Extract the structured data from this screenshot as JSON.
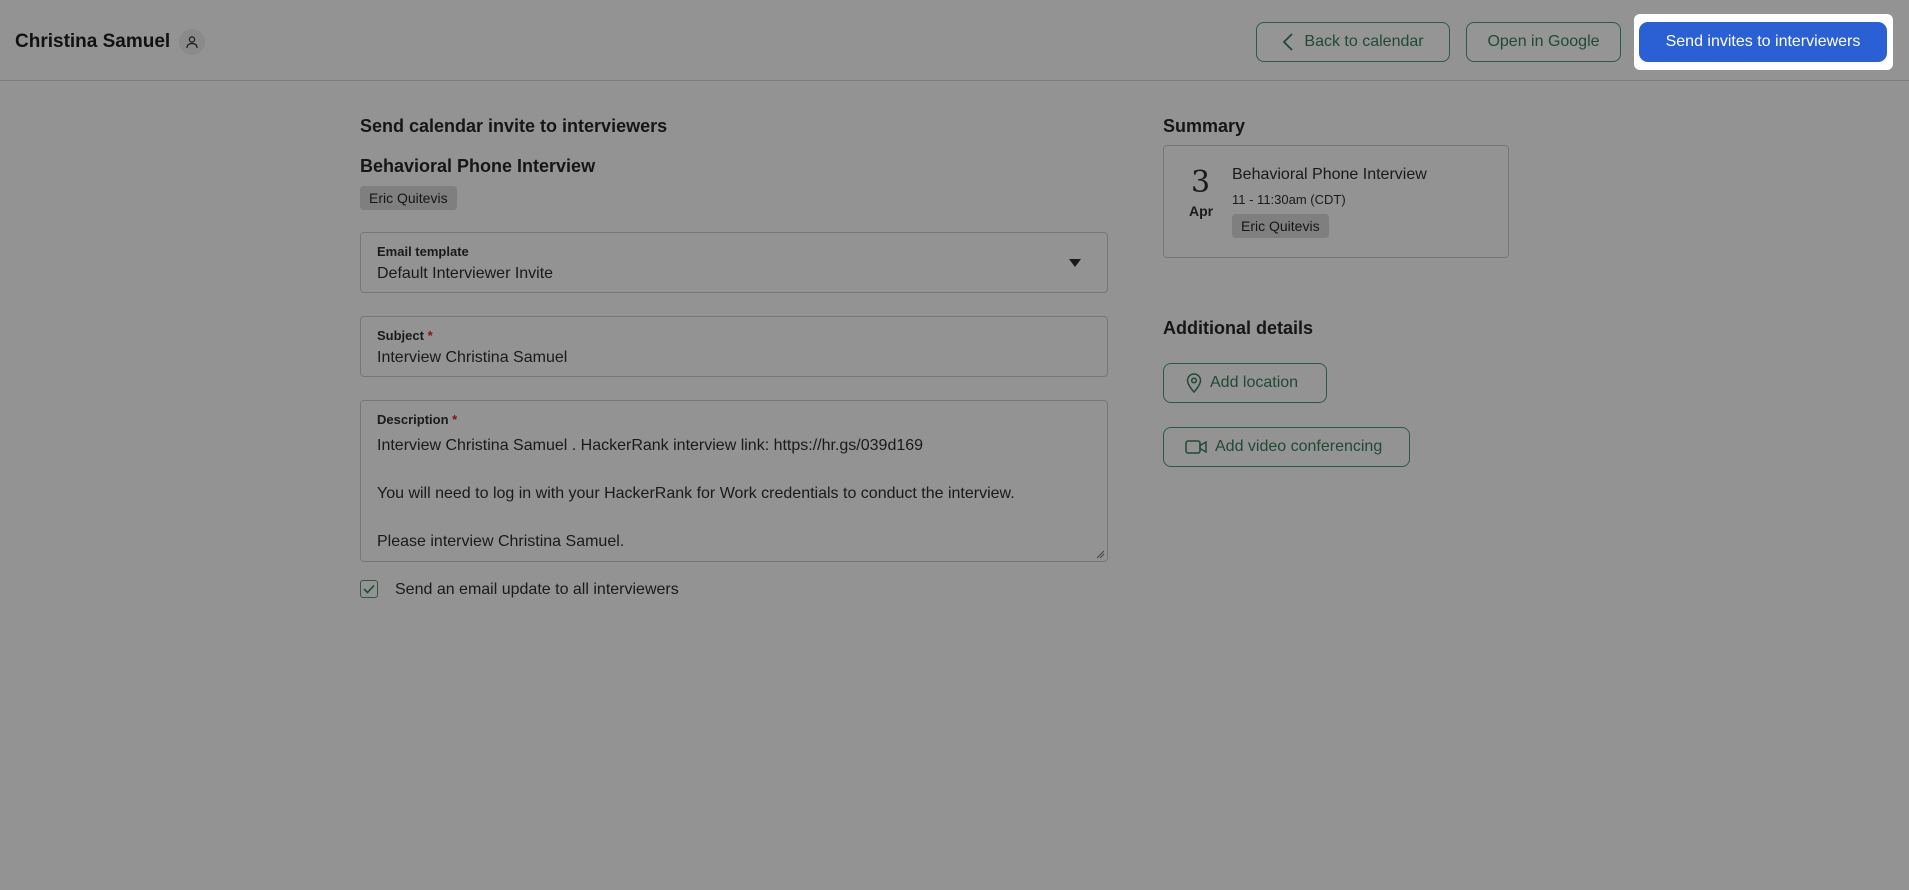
{
  "header": {
    "candidate_name": "Christina Samuel",
    "back_label": "Back to calendar",
    "google_label": "Open in Google",
    "send_label": "Send invites to interviewers"
  },
  "form": {
    "title": "Send calendar invite to interviewers",
    "interview_name": "Behavioral Phone Interview",
    "interviewer_chip": "Eric Quitevis",
    "email_template": {
      "label": "Email template",
      "value": "Default Interviewer Invite"
    },
    "subject": {
      "label": "Subject",
      "required_mark": "*",
      "value": "Interview Christina Samuel"
    },
    "description": {
      "label": "Description",
      "required_mark": "*",
      "lines": [
        "Interview Christina Samuel . HackerRank interview link: https://hr.gs/039d169",
        "You will need to log in with your HackerRank for Work credentials to conduct the interview.",
        "Please interview Christina Samuel."
      ]
    },
    "email_update": {
      "label": "Send an email update to all interviewers",
      "checked": true
    }
  },
  "summary": {
    "title": "Summary",
    "day": "3",
    "month": "Apr",
    "event_title": "Behavioral Phone Interview",
    "time": "11 - 11:30am (CDT)",
    "interviewer_chip": "Eric Quitevis"
  },
  "additional": {
    "title": "Additional details",
    "location_label": "Add location",
    "video_label": "Add video conferencing"
  },
  "colors": {
    "background": "#939393",
    "primary": "#2b5fd4",
    "outline": "#2d5a44"
  }
}
